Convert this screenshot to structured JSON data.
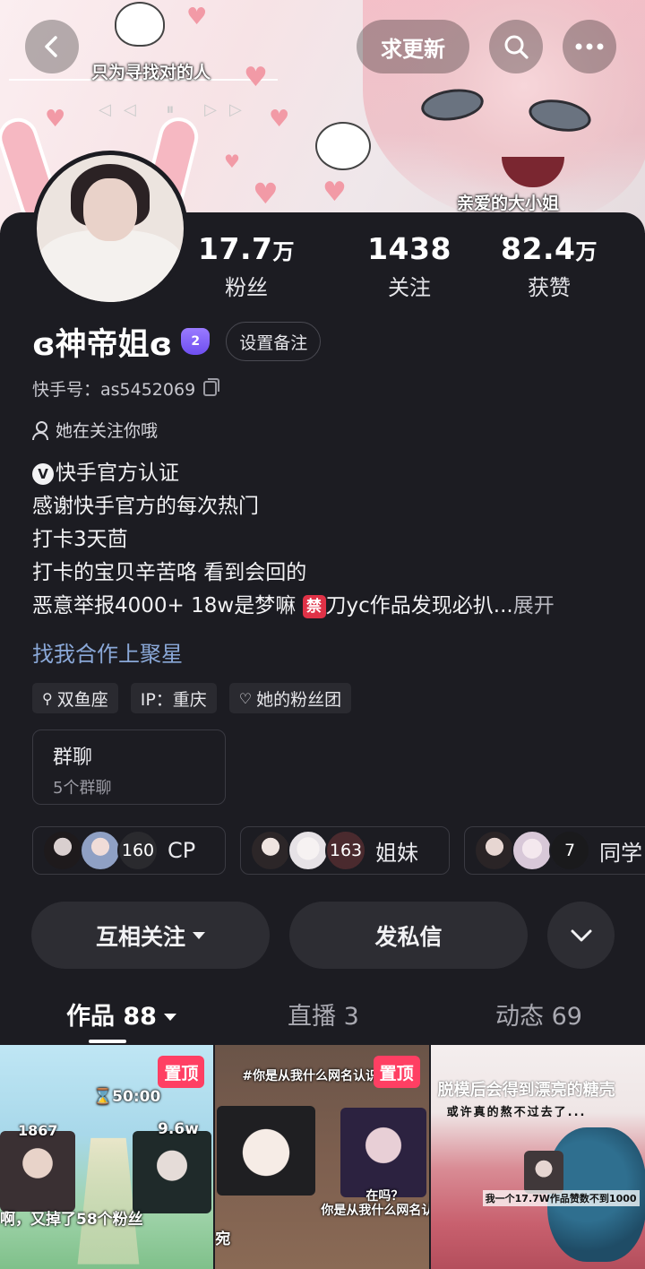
{
  "banner": {
    "caption_left": "只为寻找对的人",
    "caption_right": "亲爱的大小姐"
  },
  "top_bar": {
    "back_icon": "chevron-left-icon",
    "request_update_label": "求更新",
    "search_icon": "search-icon",
    "more_icon": "more-dots-icon"
  },
  "stats": [
    {
      "number": "17.7",
      "unit": "万",
      "label": "粉丝"
    },
    {
      "number": "1438",
      "unit": "",
      "label": "关注"
    },
    {
      "number": "82.4",
      "unit": "万",
      "label": "获赞"
    }
  ],
  "profile": {
    "name": "ɞ神帝姐ɞ",
    "level": "2",
    "remark_button": "设置备注",
    "kuaishou_id": "快手号：as5452069",
    "follows_you": "她在关注你哦"
  },
  "bio": {
    "verified": "快手官方认证",
    "line2": "感谢快手官方的每次热门",
    "line3": "打卡3天茴",
    "line4": "打卡的宝贝辛苦咯 看到会回的",
    "line5_a": "恶意举报4000+ 18w是梦嘛 ",
    "ban_emoji": "禁",
    "line5_b": "刀yc作品发现必扒...",
    "expand": "展开"
  },
  "cooperate_link": "找我合作上聚星",
  "tags": [
    {
      "icon": "zodiac-icon",
      "label": "双鱼座"
    },
    {
      "label": "IP：重庆"
    },
    {
      "icon": "fan-club-icon",
      "label": "她的粉丝团"
    }
  ],
  "group_chat": {
    "title": "群聊",
    "subtitle": "5个群聊"
  },
  "circles": [
    {
      "count": "160",
      "label": "CP"
    },
    {
      "count": "163",
      "label": "姐妹"
    },
    {
      "count": "7",
      "label": "同学"
    }
  ],
  "actions": {
    "mutual_follow": "互相关注",
    "message": "发私信",
    "expand_icon": "chevron-down-icon"
  },
  "tabs": [
    {
      "label": "作品 88",
      "active": true
    },
    {
      "label": "直播 3",
      "active": false
    },
    {
      "label": "动态 69",
      "active": false
    }
  ],
  "works": [
    {
      "pinned": "置顶",
      "timer": "⌛50:00",
      "left_count": "1867",
      "right_count": "9.6w",
      "caption": "啊，又掉了58个粉丝"
    },
    {
      "pinned": "置顶",
      "top_text": "#你是从我什么网名认识我",
      "bubble": "在吗？",
      "sub": "你是从我什么网名认识",
      "edge": "宛"
    },
    {
      "title": "脱模后会得到漂亮的糖壳",
      "sub": "或许真的熬不过去了...",
      "caption": "我一个17.7W作品赞数不到1000"
    }
  ],
  "colors": {
    "background": "#1c1c22",
    "pin": "#ff3f63",
    "link": "#8aa8d8",
    "level_badge": "#7b5cf5"
  }
}
